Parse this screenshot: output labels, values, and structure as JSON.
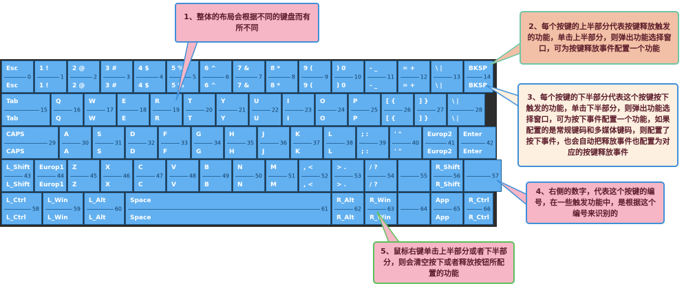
{
  "callouts": {
    "c1": "1、整体的布局会根据不同的键盘而有所不同",
    "c2": "2、每个按键的上半部分代表按键释放触发的功能，单击上半部分，则弹出功能选择窗口，可为按键释放事件配置一个功能",
    "c3": "3、每个按键的下半部分代表这个按键按下触发的功能，单击下半部分，则弹出功能选择窗口，可为按下事件配置一个功能，如果配置的是常规键码和多媒体键码，则配置了按下事件，也会自动把释放事件也配置为对应的按键释放事件",
    "c4": "4、右侧的数字，代表这个按键的编号，在一些触发功能中，是根据这个编号来识别的",
    "c5": "5、鼠标右键单击上半部分或者下半部分，则会清空按下或者释放按钮所配置的功能"
  },
  "colors": {
    "key": "#62b0f0",
    "board": "#2d2d2d"
  },
  "keys": [
    {
      "up": "Esc",
      "dn": "Esc",
      "num": "0"
    },
    {
      "up": "1 !",
      "dn": "1 !",
      "num": "1"
    },
    {
      "up": "2 @",
      "dn": "2 @",
      "num": "2"
    },
    {
      "up": "3 #",
      "dn": "3 #",
      "num": "3"
    },
    {
      "up": "4 $",
      "dn": "4 $",
      "num": "4"
    },
    {
      "up": "5 %",
      "dn": "5 %",
      "num": "5"
    },
    {
      "up": "6 ^",
      "dn": "6 ^",
      "num": "6"
    },
    {
      "up": "7 &",
      "dn": "7 &",
      "num": "7"
    },
    {
      "up": "8 *",
      "dn": "8 *",
      "num": "8"
    },
    {
      "up": "9 (",
      "dn": "9 (",
      "num": "9"
    },
    {
      "up": ") 0",
      "dn": ") 0",
      "num": "10"
    },
    {
      "up": "- _",
      "dn": "- _",
      "num": "11"
    },
    {
      "up": "= +",
      "dn": "= +",
      "num": "12"
    },
    {
      "up": "\\ |",
      "dn": "\\ |",
      "num": "13"
    },
    {
      "up": "BKSP",
      "dn": "BKSP",
      "num": "14"
    },
    {
      "up": "Tab",
      "dn": "Tab",
      "num": "15"
    },
    {
      "up": "Q",
      "dn": "Q",
      "num": "16"
    },
    {
      "up": "W",
      "dn": "W",
      "num": "17"
    },
    {
      "up": "E",
      "dn": "E",
      "num": "18"
    },
    {
      "up": "R",
      "dn": "R",
      "num": "19"
    },
    {
      "up": "T",
      "dn": "T",
      "num": "20"
    },
    {
      "up": "Y",
      "dn": "Y",
      "num": "21"
    },
    {
      "up": "U",
      "dn": "U",
      "num": "22"
    },
    {
      "up": "I",
      "dn": "I",
      "num": "23"
    },
    {
      "up": "O",
      "dn": "O",
      "num": "24"
    },
    {
      "up": "P",
      "dn": "P",
      "num": "25"
    },
    {
      "up": "[ {",
      "dn": "[ {",
      "num": "26"
    },
    {
      "up": "] }",
      "dn": "] }",
      "num": "27"
    },
    {
      "up": "\\ |",
      "dn": "\\ |",
      "num": "28"
    },
    {
      "up": "CAPS",
      "dn": "CAPS",
      "num": "29"
    },
    {
      "up": "A",
      "dn": "A",
      "num": "30"
    },
    {
      "up": "S",
      "dn": "S",
      "num": "31"
    },
    {
      "up": "D",
      "dn": "D",
      "num": "32"
    },
    {
      "up": "F",
      "dn": "F",
      "num": "33"
    },
    {
      "up": "G",
      "dn": "G",
      "num": "34"
    },
    {
      "up": "H",
      "dn": "H",
      "num": "35"
    },
    {
      "up": "J",
      "dn": "J",
      "num": "36"
    },
    {
      "up": "K",
      "dn": "K",
      "num": "37"
    },
    {
      "up": "L",
      "dn": "L",
      "num": "38"
    },
    {
      "up": "; :",
      "dn": "; :",
      "num": "39"
    },
    {
      "up": "' \"",
      "dn": "' \"",
      "num": "40"
    },
    {
      "up": "Europ2",
      "dn": "Europ2",
      "num": "41"
    },
    {
      "up": "Enter",
      "dn": "Enter",
      "num": "42"
    },
    {
      "up": "L_Shift",
      "dn": "L_Shift",
      "num": "43"
    },
    {
      "up": "Europ1",
      "dn": "Europ1",
      "num": "44"
    },
    {
      "up": "Z",
      "dn": "Z",
      "num": "45"
    },
    {
      "up": "X",
      "dn": "X",
      "num": "46"
    },
    {
      "up": "C",
      "dn": "C",
      "num": "47"
    },
    {
      "up": "V",
      "dn": "V",
      "num": "48"
    },
    {
      "up": "B",
      "dn": "B",
      "num": "49"
    },
    {
      "up": "N",
      "dn": "N",
      "num": "50"
    },
    {
      "up": "M",
      "dn": "M",
      "num": "51"
    },
    {
      "up": ", <",
      "dn": ", <",
      "num": "52"
    },
    {
      "up": "> .",
      "dn": "> .",
      "num": "53"
    },
    {
      "up": "/ ?",
      "dn": "/ ?",
      "num": "54"
    },
    {
      "up": "",
      "dn": "",
      "num": "55"
    },
    {
      "up": "R_Shift",
      "dn": "R_Shift",
      "num": "56"
    },
    {
      "up": "",
      "dn": "",
      "num": "57"
    },
    {
      "up": "L_Ctrl",
      "dn": "L_Ctrl",
      "num": "58"
    },
    {
      "up": "L_Win",
      "dn": "L_Win",
      "num": "59"
    },
    {
      "up": "L_Alt",
      "dn": "L_Alt",
      "num": "60"
    },
    {
      "up": "Space",
      "dn": "Space",
      "num": "61"
    },
    {
      "up": "R_Alt",
      "dn": "R_Alt",
      "num": "62"
    },
    {
      "up": "R_Win",
      "dn": "R_Win",
      "num": "63"
    },
    {
      "up": "",
      "dn": "",
      "num": "64"
    },
    {
      "up": "App",
      "dn": "App",
      "num": "65"
    },
    {
      "up": "R_Ctrl",
      "dn": "R_Ctrl",
      "num": "66"
    }
  ]
}
